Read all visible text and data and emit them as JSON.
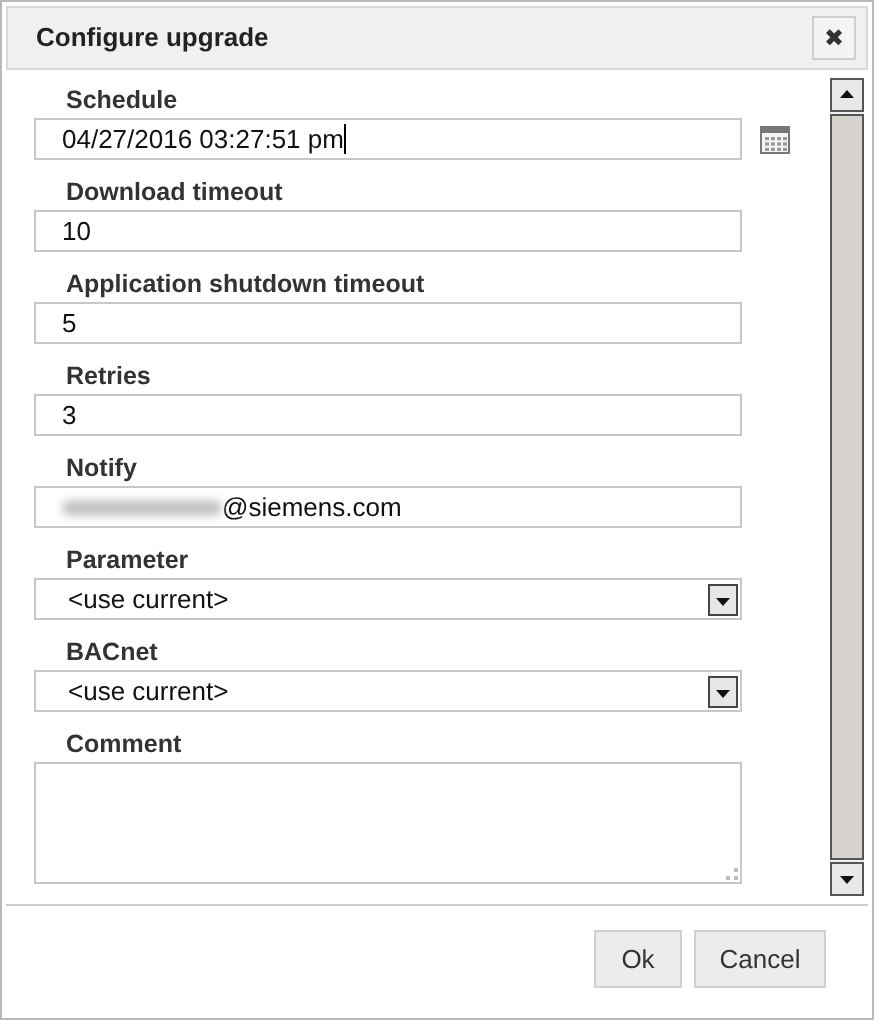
{
  "dialog": {
    "title": "Configure upgrade",
    "close": "✖"
  },
  "fields": [
    {
      "kind": "datetime",
      "label": "Schedule",
      "value": "04/27/2016 03:27:51 pm",
      "focused": true
    },
    {
      "kind": "text",
      "label": "Download timeout",
      "value": "10"
    },
    {
      "kind": "text",
      "label": "Application shutdown timeout",
      "value": "5"
    },
    {
      "kind": "text",
      "label": "Retries",
      "value": "3"
    },
    {
      "kind": "text",
      "label": "Notify",
      "value": "@siemens.com",
      "redacted_prefix": true
    },
    {
      "kind": "select",
      "label": "Parameter",
      "value": "<use current>"
    },
    {
      "kind": "select",
      "label": "BACnet",
      "value": "<use current>"
    },
    {
      "kind": "textarea",
      "label": "Comment"
    }
  ],
  "buttons": [
    {
      "label": "Ok"
    },
    {
      "label": "Cancel"
    }
  ]
}
